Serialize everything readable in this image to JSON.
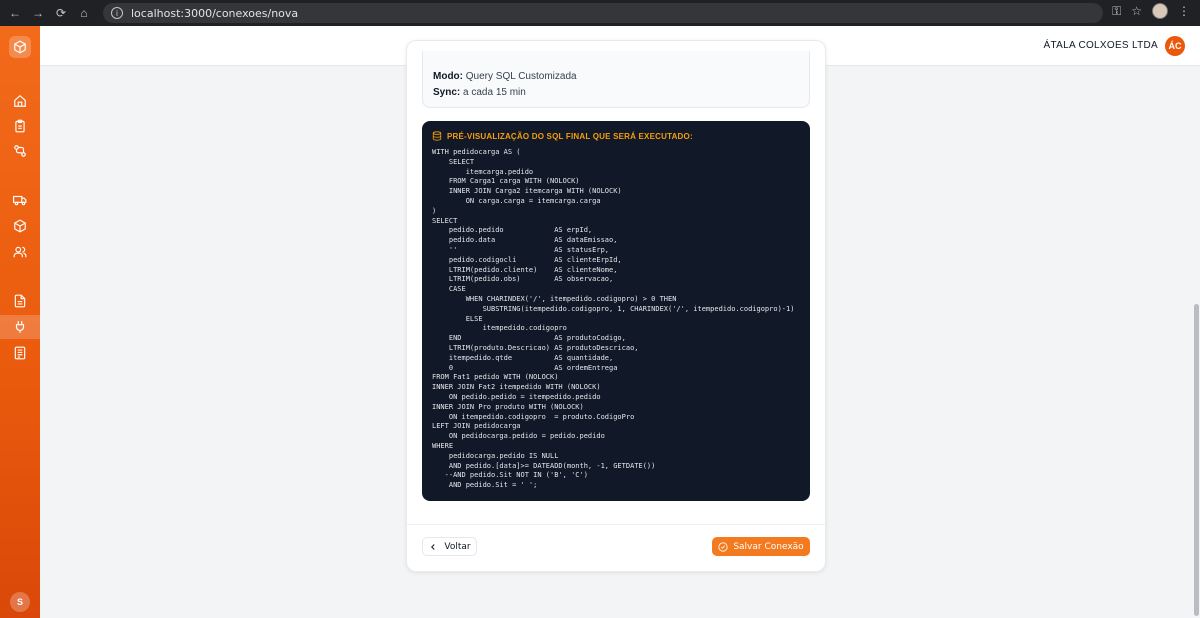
{
  "browser": {
    "url": "localhost:3000/conexoes/nova"
  },
  "header": {
    "company": "ÁTALA COLXOES LTDA",
    "avatar_initials": "ÁC"
  },
  "sidebar": {
    "user_initial": "S",
    "icons": [
      "home-icon",
      "clipboard-icon",
      "workflow-icon",
      "truck-icon",
      "package-icon",
      "users-icon",
      "document-icon",
      "plug-icon",
      "receipt-icon"
    ],
    "active": "plug-icon"
  },
  "summary": {
    "mode_label": "Modo:",
    "mode_value": "Query SQL Customizada",
    "sync_label": "Sync:",
    "sync_value": "a cada 15 min"
  },
  "sql_preview": {
    "title": "PRÉ-VISUALIZAÇÃO DO SQL FINAL QUE SERÁ EXECUTADO:",
    "code": "WITH pedidocarga AS (\n    SELECT\n        itemcarga.pedido\n    FROM Carga1 carga WITH (NOLOCK)\n    INNER JOIN Carga2 itemcarga WITH (NOLOCK)\n        ON carga.carga = itemcarga.carga\n)\nSELECT\n    pedido.pedido            AS erpId,\n    pedido.data              AS dataEmissao,\n    ''                       AS statusErp,\n    pedido.codigocli         AS clienteErpId,\n    LTRIM(pedido.cliente)    AS clienteNome,\n    LTRIM(pedido.obs)        AS observacao,\n    CASE\n        WHEN CHARINDEX('/', itempedido.codigopro) > 0 THEN\n            SUBSTRING(itempedido.codigopro, 1, CHARINDEX('/', itempedido.codigopro)-1)\n        ELSE\n            itempedido.codigopro\n    END                      AS produtoCodigo,\n    LTRIM(produto.Descricao) AS produtoDescricao,\n    itempedido.qtde          AS quantidade,\n    0                        AS ordemEntrega\nFROM Fat1 pedido WITH (NOLOCK)\nINNER JOIN Fat2 itempedido WITH (NOLOCK)\n    ON pedido.pedido = itempedido.pedido\nINNER JOIN Pro produto WITH (NOLOCK)\n    ON itempedido.codigopro  = produto.CodigoPro\nLEFT JOIN pedidocarga\n    ON pedidocarga.pedido = pedido.pedido\nWHERE\n    pedidocarga.pedido IS NULL\n    AND pedido.[data]>= DATEADD(month, -1, GETDATE())\n   --AND pedido.Sit NOT IN ('B', 'C')\n    AND pedido.Sit = ' ';"
  },
  "actions": {
    "back_label": "Voltar",
    "save_label": "Salvar Conexão"
  },
  "colors": {
    "accent": "#f47a1f",
    "sidebar": "#ea5a0c",
    "code_bg": "#111827",
    "code_title": "#f59e0b"
  }
}
